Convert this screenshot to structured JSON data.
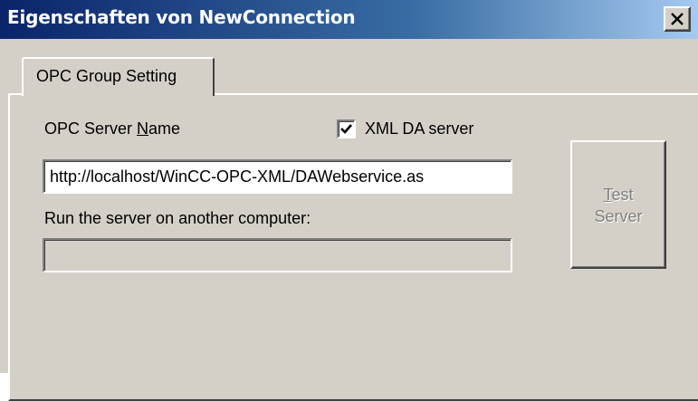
{
  "window": {
    "title": "Eigenschaften von NewConnection"
  },
  "tabs": [
    {
      "label": "OPC Group Setting",
      "selected": true
    }
  ],
  "form": {
    "server_name_label_pre": "OPC Server ",
    "server_name_label_mnemonic": "N",
    "server_name_label_post": "ame",
    "xml_da_checkbox": {
      "label": "XML DA server",
      "checked": true
    },
    "server_url_value": "http://localhost/WinCC-OPC-XML/DAWebservice.as",
    "remote_label": "Run the server on another computer:",
    "remote_computer_value": ""
  },
  "buttons": {
    "test_server_mnemonic": "T",
    "test_server_line1_rest": "est",
    "test_server_line2": "Server",
    "test_server_enabled": false
  },
  "icons": {
    "close": "close-x-icon",
    "checkmark": "check-icon"
  },
  "colors": {
    "titlebar_start": "#0a246a",
    "titlebar_end": "#a6caf0",
    "face": "#d4d0c8"
  }
}
